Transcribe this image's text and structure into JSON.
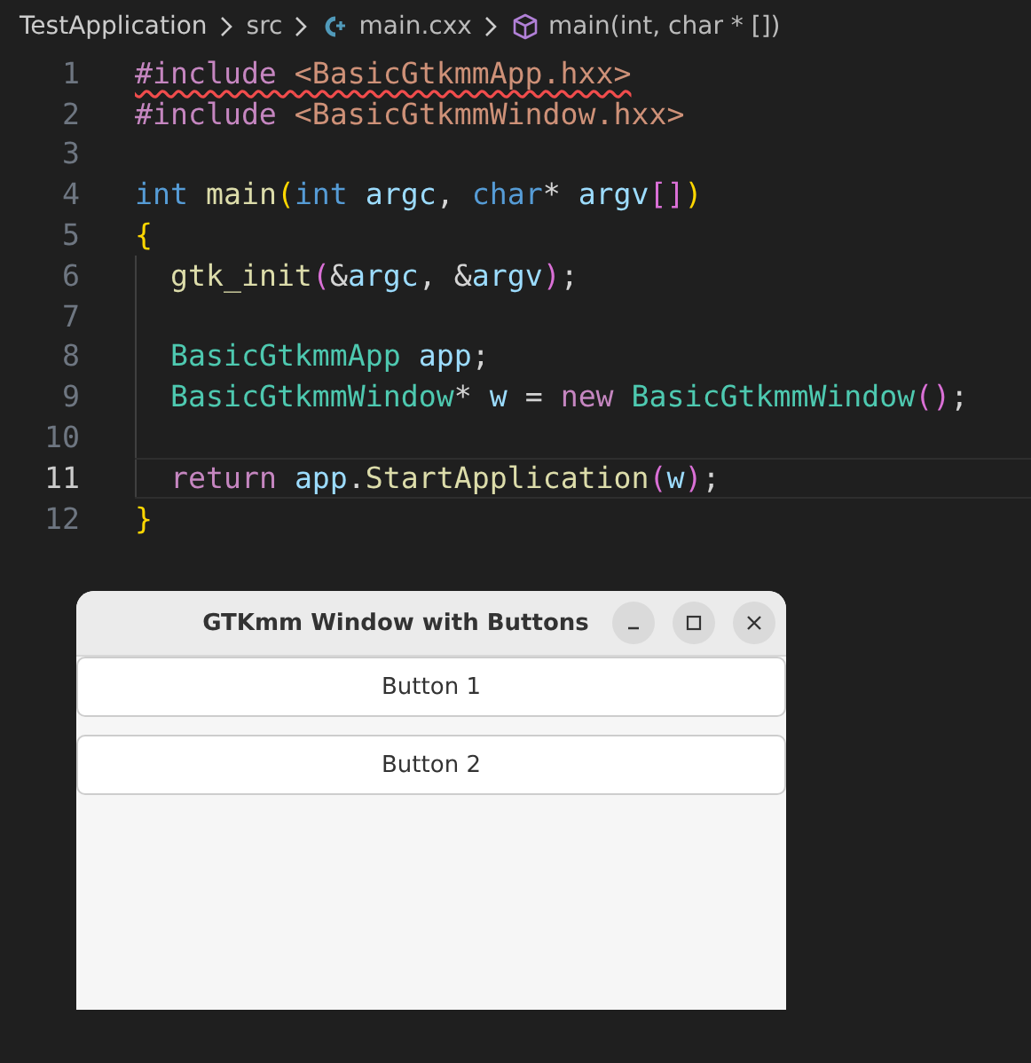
{
  "breadcrumb": [
    {
      "label": "TestApplication",
      "kind": "folder"
    },
    {
      "label": "src",
      "kind": "folder"
    },
    {
      "label": "main.cxx",
      "kind": "file"
    },
    {
      "label": "main(int, char * [])",
      "kind": "symbol"
    }
  ],
  "code_lines": [
    {
      "number": "1",
      "current": false,
      "indented": false,
      "error": true,
      "tokens": [
        {
          "t": "#include ",
          "kind": "directive"
        },
        {
          "t": "<BasicGtkmmApp.hxx>",
          "kind": "string"
        }
      ]
    },
    {
      "number": "2",
      "current": false,
      "indented": false,
      "error": false,
      "tokens": [
        {
          "t": "#include ",
          "kind": "directive"
        },
        {
          "t": "<BasicGtkmmWindow.hxx>",
          "kind": "string"
        }
      ]
    },
    {
      "number": "3",
      "current": false,
      "indented": false
    },
    {
      "number": "4",
      "current": false,
      "indented": false,
      "error": false,
      "tokens": [
        {
          "t": "int ",
          "kind": "keyword"
        },
        {
          "t": "main",
          "kind": "func"
        },
        {
          "t": "(",
          "kind": "bracket1"
        },
        {
          "t": "int ",
          "kind": "keyword"
        },
        {
          "t": "argc",
          "kind": "var"
        },
        {
          "t": ", ",
          "kind": "plain"
        },
        {
          "t": "char",
          "kind": "keyword"
        },
        {
          "t": "* ",
          "kind": "plain"
        },
        {
          "t": "argv",
          "kind": "var"
        },
        {
          "t": "[]",
          "kind": "bracket2"
        },
        {
          "t": ")",
          "kind": "bracket1"
        }
      ]
    },
    {
      "number": "5",
      "current": false,
      "indented": false,
      "error": false,
      "tokens": [
        {
          "t": "{",
          "kind": "bracket1"
        }
      ]
    },
    {
      "number": "6",
      "current": false,
      "indented": true,
      "error": false,
      "tokens": [
        {
          "t": "gtk_init",
          "kind": "func"
        },
        {
          "t": "(",
          "kind": "bracket2"
        },
        {
          "t": "&",
          "kind": "plain"
        },
        {
          "t": "argc",
          "kind": "var"
        },
        {
          "t": ", &",
          "kind": "plain"
        },
        {
          "t": "argv",
          "kind": "var"
        },
        {
          "t": ")",
          "kind": "bracket2"
        },
        {
          "t": ";",
          "kind": "plain"
        }
      ]
    },
    {
      "number": "7",
      "current": false,
      "indented": true
    },
    {
      "number": "8",
      "current": false,
      "indented": true,
      "error": false,
      "tokens": [
        {
          "t": "BasicGtkmmApp ",
          "kind": "type"
        },
        {
          "t": "app",
          "kind": "var"
        },
        {
          "t": ";",
          "kind": "plain"
        }
      ]
    },
    {
      "number": "9",
      "current": false,
      "indented": true,
      "error": false,
      "tokens": [
        {
          "t": "BasicGtkmmWindow",
          "kind": "type"
        },
        {
          "t": "* ",
          "kind": "plain"
        },
        {
          "t": "w",
          "kind": "var"
        },
        {
          "t": " = ",
          "kind": "plain"
        },
        {
          "t": "new ",
          "kind": "control"
        },
        {
          "t": "BasicGtkmmWindow",
          "kind": "type"
        },
        {
          "t": "()",
          "kind": "bracket2"
        },
        {
          "t": ";",
          "kind": "plain"
        }
      ]
    },
    {
      "number": "10",
      "current": false,
      "indented": true
    },
    {
      "number": "11",
      "current": true,
      "indented": true,
      "error": false,
      "tokens": [
        {
          "t": "return ",
          "kind": "control"
        },
        {
          "t": "app",
          "kind": "var"
        },
        {
          "t": ".",
          "kind": "plain"
        },
        {
          "t": "StartApplication",
          "kind": "func"
        },
        {
          "t": "(",
          "kind": "bracket2"
        },
        {
          "t": "w",
          "kind": "var"
        },
        {
          "t": ")",
          "kind": "bracket2"
        },
        {
          "t": ";",
          "kind": "plain"
        }
      ]
    },
    {
      "number": "12",
      "current": false,
      "indented": false,
      "error": false,
      "tokens": [
        {
          "t": "}",
          "kind": "bracket1"
        }
      ]
    }
  ],
  "gtk_window": {
    "title": "GTKmm Window with Buttons",
    "buttons": [
      "Button 1",
      "Button 2"
    ]
  }
}
